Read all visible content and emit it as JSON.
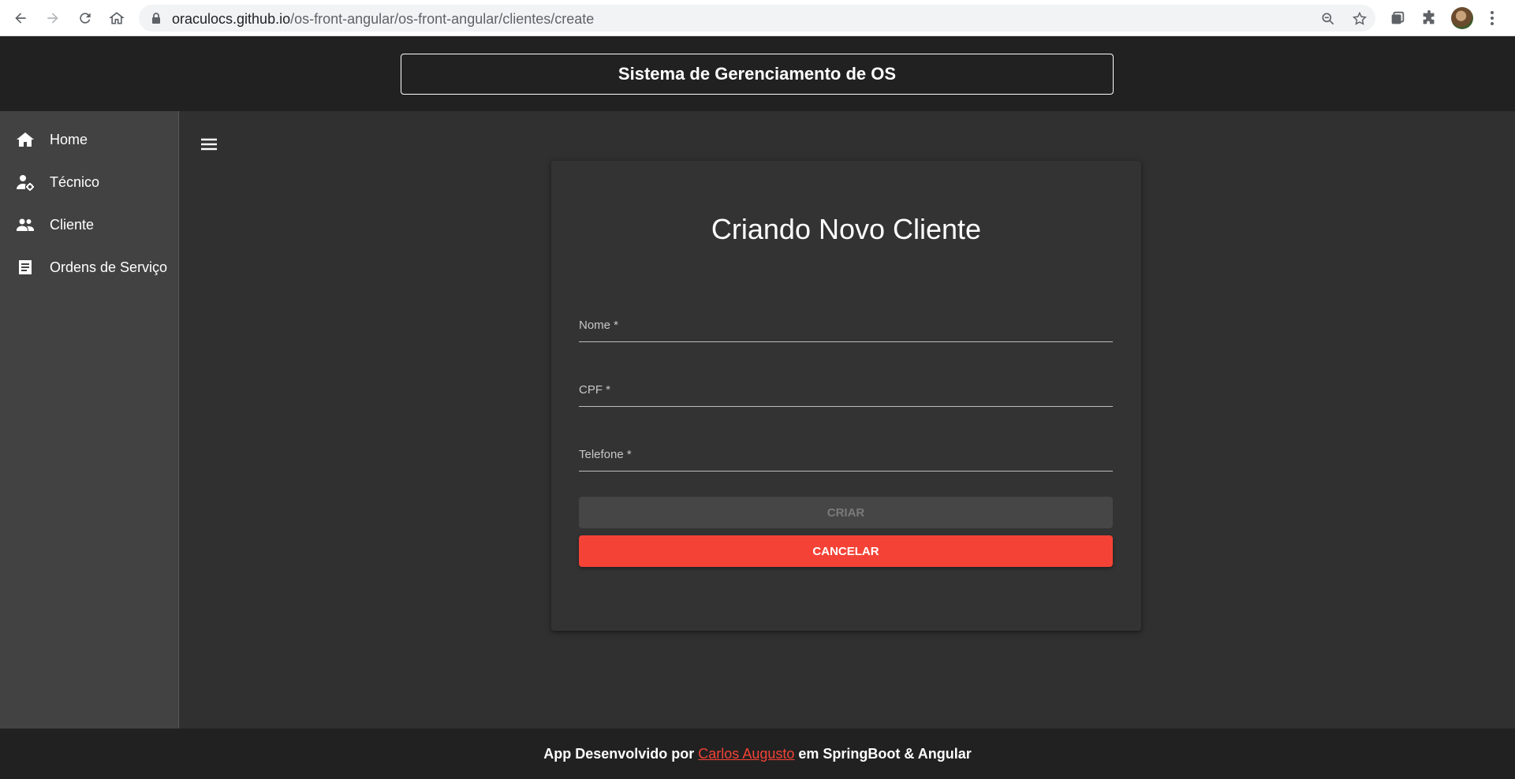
{
  "browser": {
    "url_host": "oraculocs.github.io",
    "url_path": "/os-front-angular/os-front-angular/clientes/create"
  },
  "header": {
    "title": "Sistema de Gerenciamento de OS"
  },
  "sidebar": {
    "items": [
      {
        "label": "Home",
        "icon": "home-icon"
      },
      {
        "label": "Técnico",
        "icon": "technician-icon"
      },
      {
        "label": "Cliente",
        "icon": "people-icon"
      },
      {
        "label": "Ordens de Serviço",
        "icon": "document-icon"
      }
    ]
  },
  "form": {
    "title": "Criando Novo Cliente",
    "fields": [
      {
        "label": "Nome *",
        "value": ""
      },
      {
        "label": "CPF *",
        "value": ""
      },
      {
        "label": "Telefone *",
        "value": ""
      }
    ],
    "create_label": "CRIAR",
    "cancel_label": "CANCELAR"
  },
  "footer": {
    "prefix": "App Desenvolvido por",
    "author": "Carlos Augusto",
    "suffix": "em SpringBoot & Angular"
  },
  "colors": {
    "header_bg": "#212121",
    "sidebar_bg": "#424242",
    "main_bg": "#303030",
    "accent_red": "#f44336"
  }
}
